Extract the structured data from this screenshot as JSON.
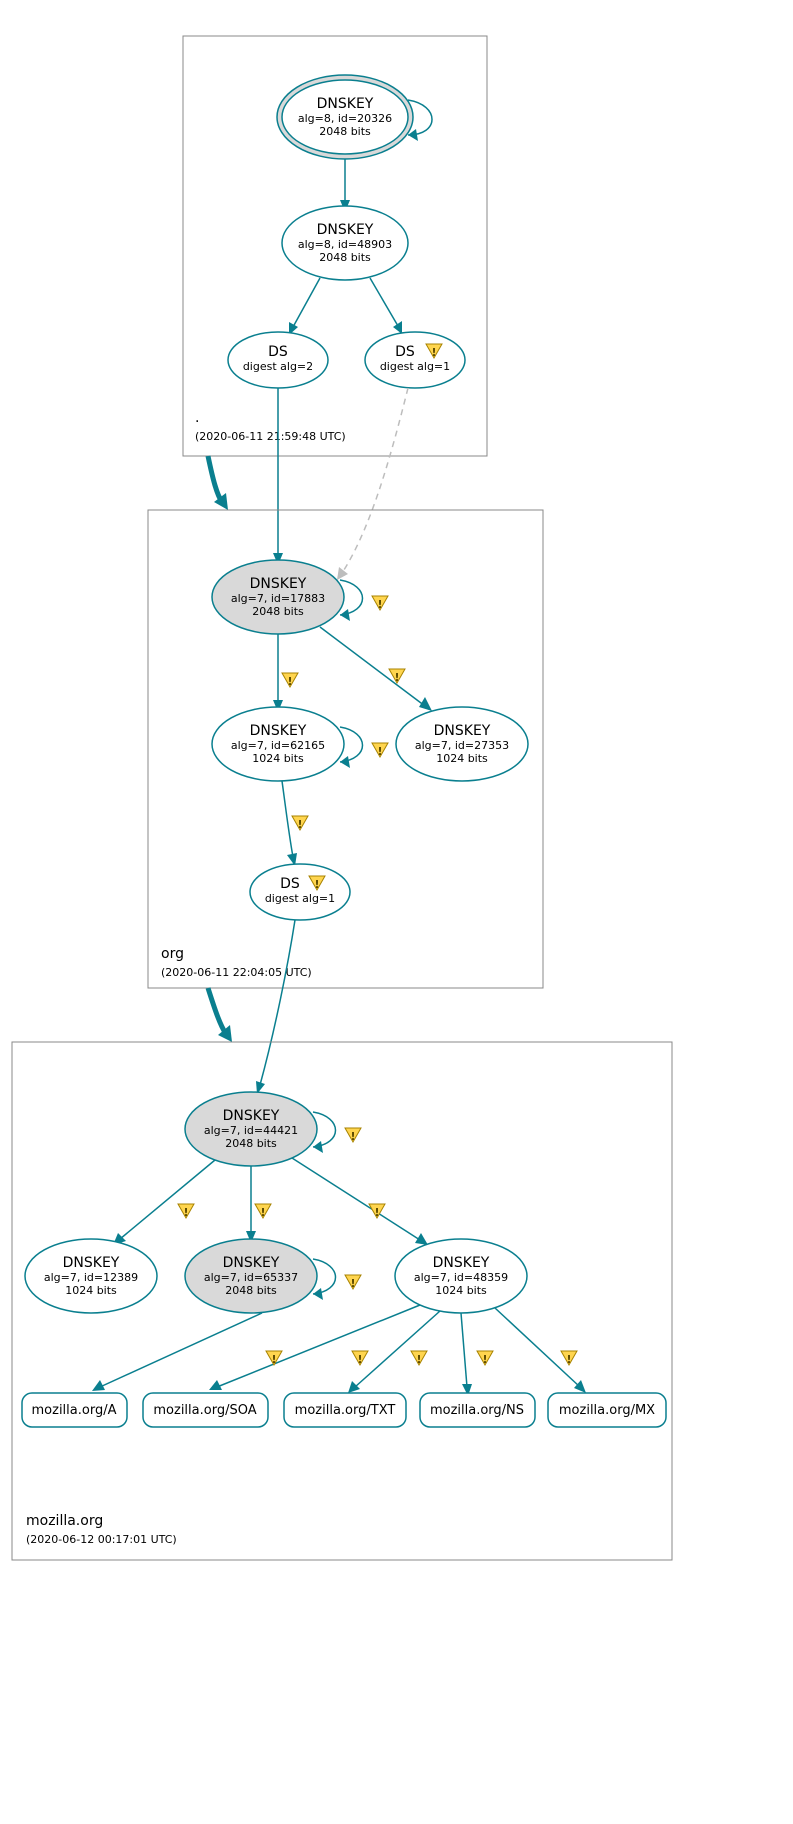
{
  "zones": {
    "root": {
      "label": ".",
      "time": "(2020-06-11 21:59:48 UTC)"
    },
    "org": {
      "label": "org",
      "time": "(2020-06-11 22:04:05 UTC)"
    },
    "moz": {
      "label": "mozilla.org",
      "time": "(2020-06-12 00:17:01 UTC)"
    }
  },
  "nodes": {
    "root_ksk": {
      "title": "DNSKEY",
      "l2": "alg=8, id=20326",
      "l3": "2048 bits"
    },
    "root_zsk": {
      "title": "DNSKEY",
      "l2": "alg=8, id=48903",
      "l3": "2048 bits"
    },
    "root_ds2": {
      "title": "DS",
      "l2": "digest alg=2"
    },
    "root_ds1": {
      "title": "DS",
      "l2": "digest alg=1"
    },
    "org_ksk": {
      "title": "DNSKEY",
      "l2": "alg=7, id=17883",
      "l3": "2048 bits"
    },
    "org_zsk1": {
      "title": "DNSKEY",
      "l2": "alg=7, id=62165",
      "l3": "1024 bits"
    },
    "org_zsk2": {
      "title": "DNSKEY",
      "l2": "alg=7, id=27353",
      "l3": "1024 bits"
    },
    "org_ds": {
      "title": "DS",
      "l2": "digest alg=1"
    },
    "moz_ksk": {
      "title": "DNSKEY",
      "l2": "alg=7, id=44421",
      "l3": "2048 bits"
    },
    "moz_k2": {
      "title": "DNSKEY",
      "l2": "alg=7, id=12389",
      "l3": "1024 bits"
    },
    "moz_k3": {
      "title": "DNSKEY",
      "l2": "alg=7, id=65337",
      "l3": "2048 bits"
    },
    "moz_k4": {
      "title": "DNSKEY",
      "l2": "alg=7, id=48359",
      "l3": "1024 bits"
    }
  },
  "rr": {
    "a": "mozilla.org/A",
    "soa": "mozilla.org/SOA",
    "txt": "mozilla.org/TXT",
    "ns": "mozilla.org/NS",
    "mx": "mozilla.org/MX"
  },
  "colors": {
    "teal": "#0a7f8f",
    "grey_node": "#d9d9d9"
  }
}
